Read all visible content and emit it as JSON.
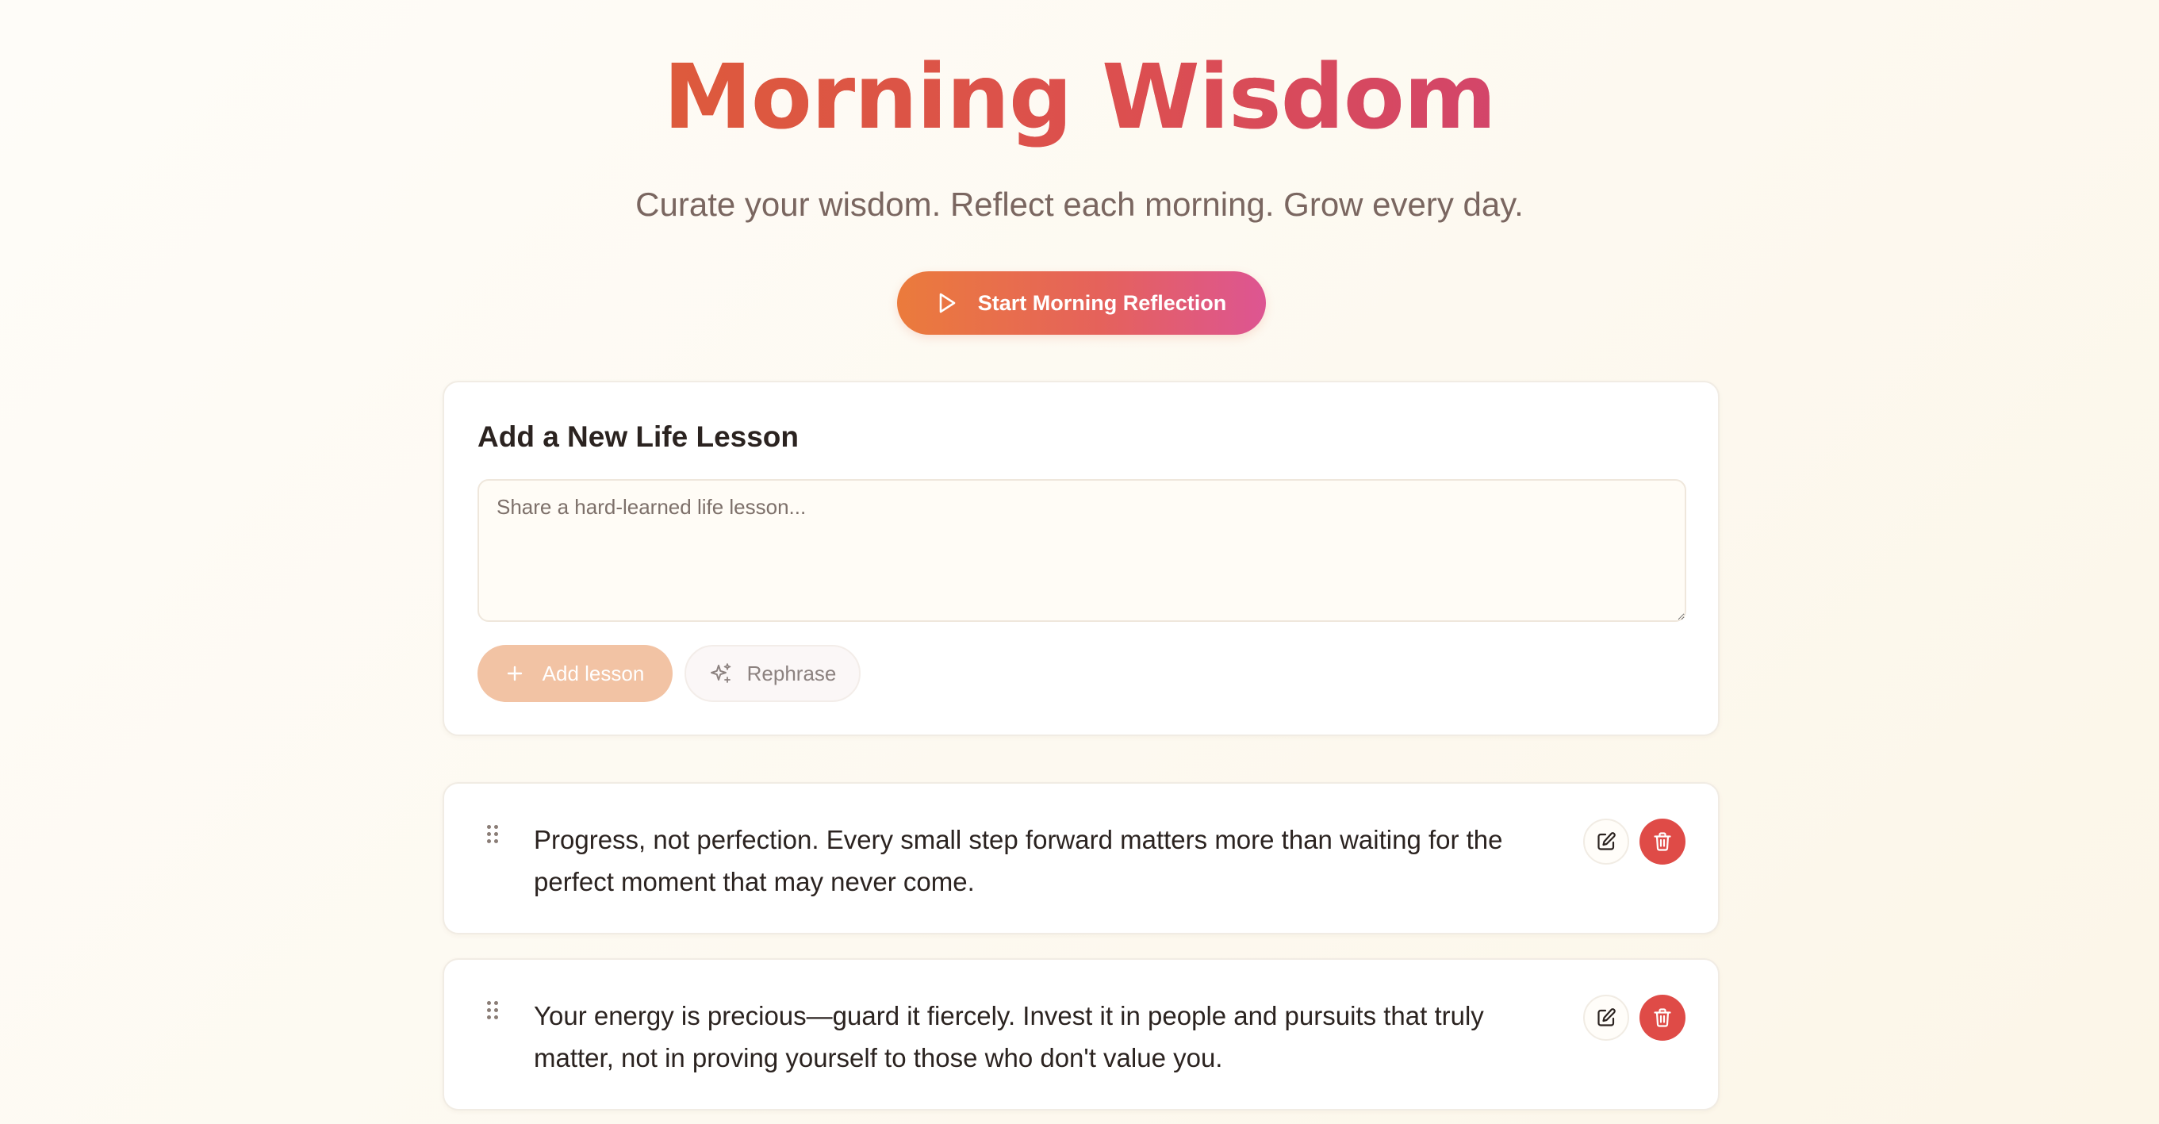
{
  "header": {
    "title": "Morning Wisdom",
    "subtitle": "Curate your wisdom. Reflect each morning. Grow every day."
  },
  "start_button": {
    "label": "Start Morning Reflection",
    "icon": "play-icon"
  },
  "add_lesson": {
    "heading": "Add a New Life Lesson",
    "placeholder": "Share a hard-learned life lesson...",
    "value": "",
    "add_button_label": "Add lesson",
    "add_button_icon": "plus-icon",
    "rephrase_button_label": "Rephrase",
    "rephrase_button_icon": "sparkles-icon"
  },
  "lessons": [
    {
      "text": "Progress, not perfection. Every small step forward matters more than waiting for the perfect moment that may never come."
    },
    {
      "text": "Your energy is precious—guard it fiercely. Invest it in people and pursuits that truly matter, not in proving yourself to those who don't value you."
    }
  ],
  "colors": {
    "title_gradient_start": "#dd5a3c",
    "title_gradient_end": "#d3456a",
    "start_gradient_start": "#eb7b3c",
    "start_gradient_end": "#dd5592",
    "add_button_bg": "#f2c3a4",
    "delete_button_bg": "#df4b47",
    "page_bg": "#fdf9f0"
  }
}
